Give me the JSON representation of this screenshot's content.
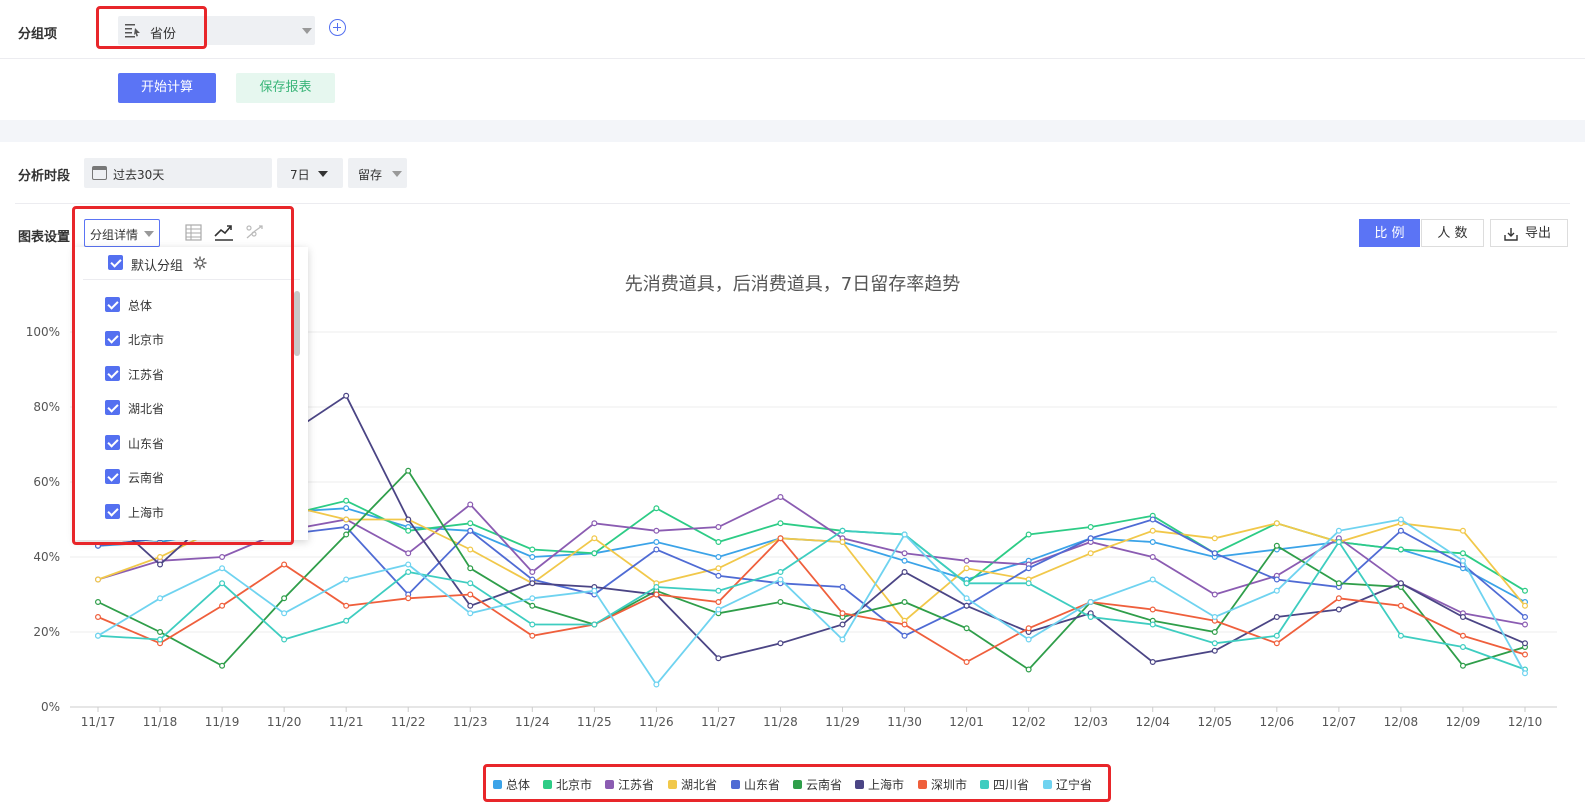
{
  "group": {
    "label": "分组项",
    "value": "省份"
  },
  "actions": {
    "start": "开始计算",
    "save": "保存报表"
  },
  "period": {
    "label": "分析时段",
    "range": "过去30天",
    "days": "7日",
    "metric": "留存"
  },
  "chart_settings": {
    "label": "图表设置",
    "dropdown": "分组详情",
    "default_group": "默认分组",
    "items": [
      "总体",
      "北京市",
      "江苏省",
      "湖北省",
      "山东省",
      "云南省",
      "上海市"
    ]
  },
  "toggle": {
    "ratio": "比 例",
    "count": "人 数",
    "export": "导出"
  },
  "colors": {
    "accent": "#5b74f5",
    "highlight": "#e8262a"
  },
  "chart_data": {
    "type": "line",
    "title": "先消费道具，后消费道具，7日留存率趋势",
    "x": [
      "11/17",
      "11/18",
      "11/19",
      "11/20",
      "11/21",
      "11/22",
      "11/23",
      "11/24",
      "11/25",
      "11/26",
      "11/27",
      "11/28",
      "11/29",
      "11/30",
      "12/01",
      "12/02",
      "12/03",
      "12/04",
      "12/05",
      "12/06",
      "12/07",
      "12/08",
      "12/09",
      "12/10"
    ],
    "ylim": [
      0,
      100
    ],
    "yticks": [
      "0%",
      "20%",
      "40%",
      "60%",
      "80%",
      "100%"
    ],
    "grid": true,
    "legend_position": "bottom",
    "series": [
      {
        "name": "总体",
        "color": "#3ba3e8",
        "values": [
          43,
          44,
          47,
          52,
          53,
          48,
          47,
          40,
          41,
          44,
          40,
          45,
          44,
          39,
          34,
          39,
          45,
          44,
          40,
          42,
          44,
          42,
          37,
          28
        ]
      },
      {
        "name": "北京市",
        "color": "#2dcc86",
        "values": [
          43,
          45,
          48,
          51,
          55,
          47,
          49,
          42,
          41,
          53,
          44,
          49,
          47,
          46,
          33,
          46,
          48,
          51,
          41,
          49,
          44,
          42,
          41,
          31
        ]
      },
      {
        "name": "江苏省",
        "color": "#8b5cb2",
        "values": [
          34,
          39,
          40,
          47,
          50,
          41,
          54,
          36,
          49,
          47,
          48,
          56,
          45,
          41,
          39,
          38,
          44,
          40,
          30,
          35,
          45,
          33,
          25,
          22
        ]
      },
      {
        "name": "湖北省",
        "color": "#f1c84a",
        "values": [
          34,
          40,
          48,
          54,
          50,
          50,
          42,
          33,
          45,
          33,
          37,
          45,
          44,
          23,
          37,
          34,
          41,
          47,
          45,
          49,
          44,
          49,
          47,
          27
        ]
      },
      {
        "name": "山东省",
        "color": "#4f6bd4",
        "values": [
          43,
          45,
          49,
          46,
          48,
          30,
          47,
          34,
          30,
          42,
          35,
          33,
          32,
          19,
          27,
          37,
          45,
          50,
          41,
          34,
          32,
          47,
          38,
          24
        ]
      },
      {
        "name": "云南省",
        "color": "#2f9e4a",
        "values": [
          28,
          20,
          11,
          29,
          46,
          63,
          37,
          27,
          22,
          31,
          25,
          28,
          24,
          28,
          21,
          10,
          28,
          23,
          20,
          43,
          33,
          32,
          11,
          16
        ]
      },
      {
        "name": "上海市",
        "color": "#4b4585",
        "values": [
          53,
          38,
          53,
          72,
          83,
          50,
          27,
          33,
          32,
          30,
          13,
          17,
          22,
          36,
          27,
          20,
          25,
          12,
          15,
          24,
          26,
          33,
          24,
          17
        ]
      },
      {
        "name": "深圳市",
        "color": "#ef5f3c",
        "values": [
          24,
          17,
          27,
          38,
          27,
          29,
          30,
          19,
          22,
          30,
          28,
          45,
          25,
          22,
          12,
          21,
          28,
          26,
          23,
          17,
          29,
          27,
          19,
          14
        ]
      },
      {
        "name": "四川省",
        "color": "#3ecdc0",
        "values": [
          19,
          18,
          33,
          18,
          23,
          36,
          33,
          22,
          22,
          32,
          31,
          36,
          47,
          46,
          33,
          33,
          24,
          22,
          17,
          19,
          44,
          19,
          16,
          10
        ]
      },
      {
        "name": "辽宁省",
        "color": "#6fd3f0",
        "values": [
          19,
          29,
          37,
          25,
          34,
          38,
          25,
          29,
          31,
          6,
          26,
          34,
          18,
          46,
          29,
          18,
          28,
          34,
          24,
          31,
          47,
          50,
          39,
          9
        ]
      }
    ]
  }
}
